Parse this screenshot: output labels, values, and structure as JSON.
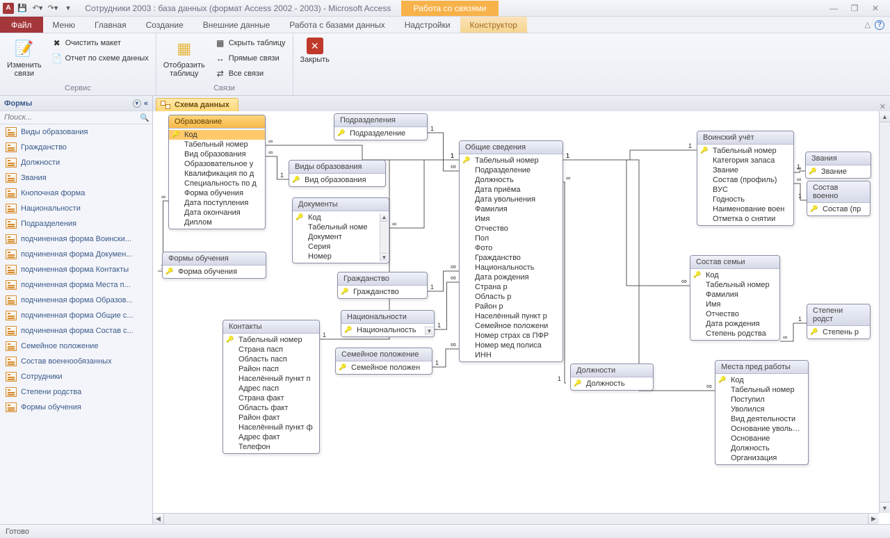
{
  "titlebar": {
    "app_letter": "A",
    "title": "Сотрудники 2003 : база данных (формат Access 2002 - 2003)  -  Microsoft Access",
    "context_title": "Работа со связями"
  },
  "tabs": {
    "file": "Файл",
    "items": [
      "Меню",
      "Главная",
      "Создание",
      "Внешние данные",
      "Работа с базами данных",
      "Надстройки"
    ],
    "context": "Конструктор"
  },
  "ribbon": {
    "group1": {
      "edit_relations": "Изменить\nсвязи",
      "clear_layout": "Очистить макет",
      "relation_report": "Отчет по схеме данных",
      "label": "Сервис"
    },
    "group2": {
      "show_table": "Отобразить\nтаблицу",
      "hide_table": "Скрыть таблицу",
      "direct_relations": "Прямые связи",
      "all_relations": "Все связи",
      "label": "Связи"
    },
    "group3": {
      "close": "Закрыть"
    }
  },
  "nav": {
    "header": "Формы",
    "search_placeholder": "Поиск...",
    "items": [
      "Виды образования",
      "Гражданство",
      "Должности",
      "Звания",
      "Кнопочная форма",
      "Национальности",
      "Подразделения",
      "подчиненная форма Воински...",
      "подчиненная форма Докумен...",
      "подчиненная форма Контакты",
      "подчиненная форма Места п...",
      "подчиненная форма Образов...",
      "подчиненная форма Общие с...",
      "подчиненная форма Состав с...",
      "Семейное положение",
      "Состав военнообязанных",
      "Сотрудники",
      "Степени родства",
      "Формы обучения"
    ]
  },
  "doc_tab": "Схема данных",
  "tables": {
    "obrazovanie": {
      "title": "Образование",
      "fields": [
        "Код",
        "Табельный номер",
        "Вид образования",
        "Образовательное у",
        "Квалификация по д",
        "Специальность по д",
        "Форма обучения",
        "Дата поступления",
        "Дата окончания",
        "Диплом"
      ],
      "keys": [
        0
      ]
    },
    "podrazdeleniya": {
      "title": "Подразделения",
      "fields": [
        "Подразделение"
      ],
      "keys": [
        0
      ]
    },
    "vidy_obr": {
      "title": "Виды образования",
      "fields": [
        "Вид образования"
      ],
      "keys": [
        0
      ]
    },
    "dokumenty": {
      "title": "Документы",
      "fields": [
        "Код",
        "Табельный номе",
        "Документ",
        "Серия",
        "Номер"
      ],
      "keys": [
        0
      ]
    },
    "formy_obuch": {
      "title": "Формы обучения",
      "fields": [
        "Форма обучения"
      ],
      "keys": [
        0
      ]
    },
    "grazhdanstvo": {
      "title": "Гражданство",
      "fields": [
        "Гражданство"
      ],
      "keys": [
        0
      ]
    },
    "natsionalnosti": {
      "title": "Национальности",
      "fields": [
        "Национальность"
      ],
      "keys": [
        0
      ]
    },
    "sem_polozh": {
      "title": "Семейное положение",
      "fields": [
        "Семейное положен"
      ],
      "keys": [
        0
      ]
    },
    "kontakty": {
      "title": "Контакты",
      "fields": [
        "Табельный номер",
        "Страна пасп",
        "Область пасп",
        "Район пасп",
        "Населённый пункт п",
        "Адрес пасп",
        "Страна факт",
        "Область факт",
        "Район факт",
        "Населённый пункт ф",
        "Адрес факт",
        "Телефон"
      ],
      "keys": [
        0
      ]
    },
    "obshchie": {
      "title": "Общие сведения",
      "fields": [
        "Табельный номер",
        "Подразделение",
        "Должность",
        "Дата приёма",
        "Дата увольнения",
        "Фамилия",
        "Имя",
        "Отчество",
        "Пол",
        "Фото",
        "Гражданство",
        "Национальность",
        "Дата рождения",
        "Страна р",
        "Область р",
        "Район р",
        "Населённый пункт р",
        "Семейное положени",
        "Номер страх св ПФР",
        "Номер мед полиса",
        "ИНН"
      ],
      "keys": [
        0
      ]
    },
    "dolzhnosti": {
      "title": "Должности",
      "fields": [
        "Должность"
      ],
      "keys": [
        0
      ]
    },
    "voinskiy": {
      "title": "Воинский учёт",
      "fields": [
        "Табельный номер",
        "Категория запаса",
        "Звание",
        "Состав (профиль)",
        "ВУС",
        "Годность",
        "Наименование воен",
        "Отметка о снятии"
      ],
      "keys": [
        0
      ]
    },
    "zvaniya": {
      "title": "Звания",
      "fields": [
        "Звание"
      ],
      "keys": [
        0
      ]
    },
    "sostav_voen": {
      "title": "Состав военно",
      "fields": [
        "Состав (пр"
      ],
      "keys": [
        0
      ]
    },
    "sostav_semi": {
      "title": "Состав семьи",
      "fields": [
        "Код",
        "Табельный номер",
        "Фамилия",
        "Имя",
        "Отчество",
        "Дата рождения",
        "Степень родства"
      ],
      "keys": [
        0
      ]
    },
    "stepeni": {
      "title": "Степени родст",
      "fields": [
        "Степень р"
      ],
      "keys": [
        0
      ]
    },
    "mesta_pred": {
      "title": "Места пред работы",
      "fields": [
        "Код",
        "Табельный номер",
        "Поступил",
        "Уволился",
        "Вид деятельности",
        "Основание увольнен",
        "Основание",
        "Должность",
        "Организация"
      ],
      "keys": [
        0
      ]
    }
  },
  "status": "Готово"
}
